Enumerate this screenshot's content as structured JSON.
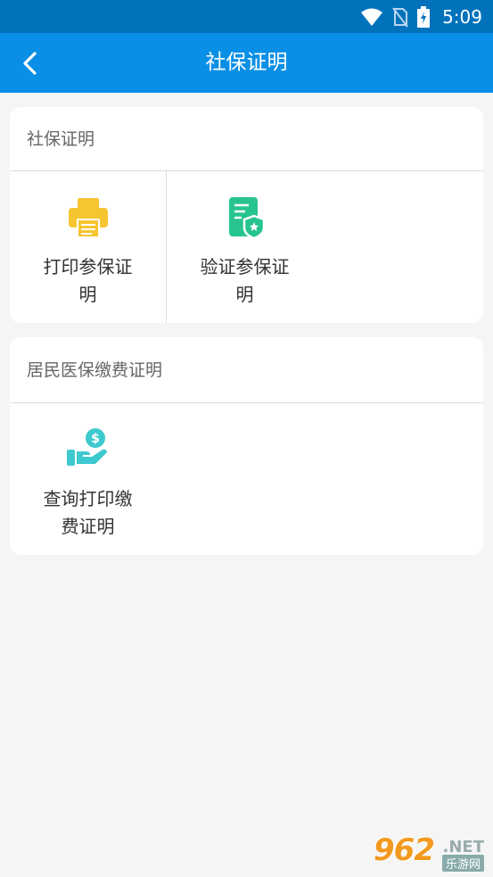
{
  "status_bar": {
    "time": "5:09",
    "icons": [
      "wifi-icon",
      "no-sim-icon",
      "battery-charging-icon"
    ]
  },
  "app_bar": {
    "title": "社保证明",
    "back_icon": "chevron-left-icon"
  },
  "sections": [
    {
      "title": "社保证明",
      "items": [
        {
          "label": "打印参保证明",
          "icon": "printer-icon",
          "color": "#f7c531"
        },
        {
          "label": "验证参保证明",
          "icon": "verified-document-icon",
          "color": "#27c48e"
        }
      ]
    },
    {
      "title": "居民医保缴费证明",
      "items": [
        {
          "label": "查询打印缴费证明",
          "icon": "hand-coin-icon",
          "color": "#3ec9cf"
        }
      ]
    }
  ],
  "watermark": {
    "number": "962",
    "suffix": ".NET",
    "sub": "乐游网"
  },
  "colors": {
    "status_bar": "#0072bc",
    "app_bar": "#0a8fe6",
    "background": "#f5f5f5"
  }
}
